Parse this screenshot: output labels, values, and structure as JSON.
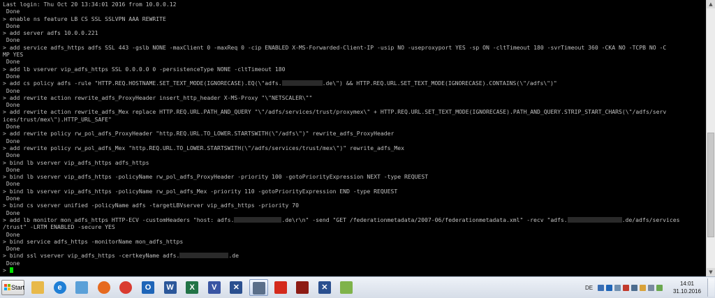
{
  "terminal": {
    "lines": [
      "Last login: Thu Oct 20 13:34:01 2016 from 10.0.0.12",
      " Done",
      "> enable ns feature LB CS SSL SSLVPN AAA REWRITE",
      " Done",
      "> add server adfs 10.0.0.221",
      " Done",
      "> add service adfs_https adfs SSL 443 -gslb NONE -maxClient 0 -maxReq 0 -cip ENABLED X-MS-Forwarded-Client-IP -usip NO -useproxyport YES -sp ON -cltTimeout 180 -svrTimeout 360 -CKA NO -TCPB NO -C",
      "MP YES",
      " Done",
      "> add lb vserver vip_adfs_https SSL 0.0.0.0 0 -persistenceType NONE -cltTimeout 180",
      " Done",
      "> add cs policy adfs -rule \"HTTP.REQ.HOSTNAME.SET_TEXT_MODE(IGNORECASE).EQ(\\\"adfs.{R}.de\\\") && HTTP.REQ.URL.SET_TEXT_MODE(IGNORECASE).CONTAINS(\\\"/adfs\\\")\"",
      " Done",
      "> add rewrite action rewrite_adfs_ProxyHeader insert_http_header X-MS-Proxy \"\\\"NETSCALER\\\"\"",
      " Done",
      "> add rewrite action rewrite_adfs_Mex replace HTTP.REQ.URL.PATH_AND_QUERY \"\\\"/adfs/services/trust/proxymex\\\" + HTTP.REQ.URL.SET_TEXT_MODE(IGNORECASE).PATH_AND_QUERY.STRIP_START_CHARS(\\\"/adfs/serv",
      "ices/trust/mex\\\").HTTP_URL_SAFE\"",
      " Done",
      "> add rewrite policy rw_pol_adfs_ProxyHeader \"http.REQ.URL.TO_LOWER.STARTSWITH(\\\"/adfs\\\")\" rewrite_adfs_ProxyHeader",
      " Done",
      "> add rewrite policy rw_pol_adfs_Mex \"http.REQ.URL.TO_LOWER.STARTSWITH(\\\"/adfs/services/trust/mex\\\")\" rewrite_adfs_Mex",
      " Done",
      "> bind lb vserver vip_adfs_https adfs_https",
      " Done",
      "> bind lb vserver vip_adfs_https -policyName rw_pol_adfs_ProxyHeader -priority 100 -gotoPriorityExpression NEXT -type REQUEST",
      " Done",
      "> bind lb vserver vip_adfs_https -policyName rw_pol_adfs_Mex -priority 110 -gotoPriorityExpression END -type REQUEST",
      " Done",
      "> bind cs vserver unified -policyName adfs -targetLBVserver vip_adfs_https -priority 70",
      " Done",
      "> add lb monitor mon_adfs_https HTTP-ECV -customHeaders \"host: adfs.{R}.de\\r\\n\" -send \"GET /federationmetadata/2007-06/federationmetadata.xml\" -recv \"adfs.{R}.de/adfs/services",
      "/trust\" -LRTM ENABLED -secure YES",
      " Done",
      "> bind service adfs_https -monitorName mon_adfs_https",
      " Done",
      "> bind ssl vserver vip_adfs_https -certkeyName adfs.{R}.de",
      " Done",
      "> {C}"
    ]
  },
  "taskbar": {
    "start_label": "Start",
    "apps": [
      {
        "name": "file-explorer-icon",
        "glyph": "",
        "color": "#e8b94a"
      },
      {
        "name": "internet-explorer-icon",
        "glyph": "e",
        "color": "#1f7fd6"
      },
      {
        "name": "network-tool-icon",
        "glyph": "",
        "color": "#5aa0d8"
      },
      {
        "name": "firefox-icon",
        "glyph": "",
        "color": "#e66a1f"
      },
      {
        "name": "chrome-icon",
        "glyph": "",
        "color": "#d93b30"
      },
      {
        "name": "outlook-icon",
        "glyph": "O",
        "color": "#1e65b8"
      },
      {
        "name": "word-icon",
        "glyph": "W",
        "color": "#2b579a"
      },
      {
        "name": "excel-icon",
        "glyph": "X",
        "color": "#217346"
      },
      {
        "name": "visio-icon",
        "glyph": "V",
        "color": "#3955a3"
      },
      {
        "name": "citrix-receiver-icon",
        "glyph": "✕",
        "color": "#2a4f8f"
      },
      {
        "name": "putty-icon",
        "glyph": "",
        "color": "#5b6f8a",
        "active": true
      },
      {
        "name": "acrobat-reader-icon",
        "glyph": "",
        "color": "#d42a1c"
      },
      {
        "name": "acrobat-icon",
        "glyph": "",
        "color": "#8d1b14"
      },
      {
        "name": "citrix-xenapp-icon",
        "glyph": "✕",
        "color": "#2a4f8f"
      },
      {
        "name": "chart-tool-icon",
        "glyph": "",
        "color": "#7fb34a"
      }
    ],
    "tray": {
      "language": "DE",
      "time": "14:01",
      "date": "31.10.2016"
    }
  }
}
